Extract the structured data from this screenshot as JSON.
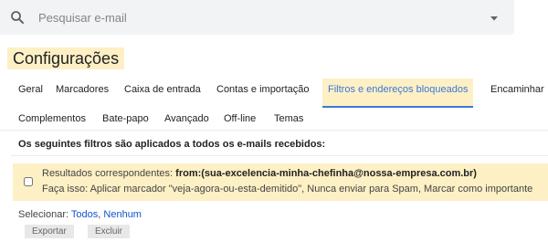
{
  "search": {
    "placeholder": "Pesquisar e-mail",
    "icon": "search-icon",
    "options_icon": "caret-down-icon"
  },
  "page": {
    "title": "Configurações"
  },
  "tabs": {
    "row1": [
      {
        "label": "Geral",
        "active": false
      },
      {
        "label": "Marcadores",
        "active": false
      },
      {
        "label": "Caixa de entrada",
        "active": false
      },
      {
        "label": "Contas e importação",
        "active": false
      },
      {
        "label": "Filtros e endereços bloqueados",
        "active": true
      },
      {
        "label": "Encaminhar",
        "active": false
      }
    ],
    "row2": [
      {
        "label": "Complementos"
      },
      {
        "label": "Bate-papo"
      },
      {
        "label": "Avançado"
      },
      {
        "label": "Off-line"
      },
      {
        "label": "Temas"
      }
    ]
  },
  "filters": {
    "heading": "Os seguintes filtros são aplicados a todos os e-mails recebidos:",
    "items": [
      {
        "match_prefix": "Resultados correspondentes:",
        "match_criteria": "from:(sua-excelencia-minha-chefinha@nossa-empresa.com.br)",
        "action": "Faça isso: Aplicar marcador \"veja-agora-ou-esta-demitido\", Nunca enviar para Spam, Marcar como importante"
      }
    ]
  },
  "selection": {
    "prefix": "Selecionar:",
    "all": "Todos",
    "separator": ",",
    "none": "Nenhum"
  },
  "actions": {
    "export": "Exportar",
    "delete": "Excluir"
  },
  "colors": {
    "highlight": "#fdf0c5",
    "active_tab": "#3c78d8",
    "link": "#1155cc",
    "search_bg": "#f1f3f4"
  }
}
